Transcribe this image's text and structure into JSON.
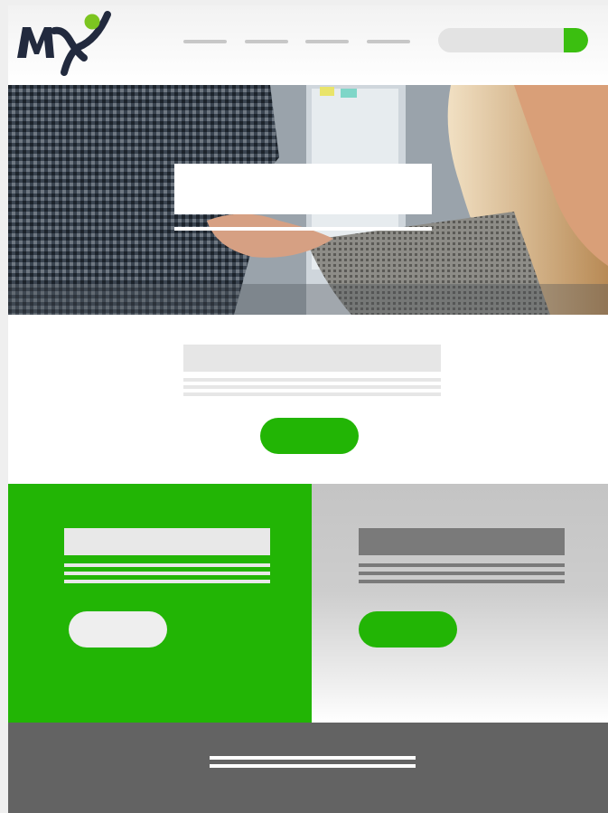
{
  "header": {
    "logo_text": "MX",
    "nav_items": [
      "",
      "",
      "",
      ""
    ],
    "search_placeholder": ""
  },
  "hero": {
    "title": "",
    "subtitle": ""
  },
  "intro": {
    "heading": "",
    "cta_label": ""
  },
  "panels": {
    "left": {
      "heading": "",
      "button_label": ""
    },
    "right": {
      "heading": "",
      "button_label": ""
    }
  },
  "footer": {
    "text": ""
  },
  "colors": {
    "brand_green": "#22b505",
    "accent_green": "#3bbf10",
    "logo_dark": "#222a3e",
    "footer_gray": "#636363",
    "placeholder_light": "#e6e6e6",
    "placeholder_dark": "#7a7a7a"
  },
  "icons": {
    "logo": "mx-logo-with-green-figure",
    "hero_image": "handshake-photo"
  }
}
